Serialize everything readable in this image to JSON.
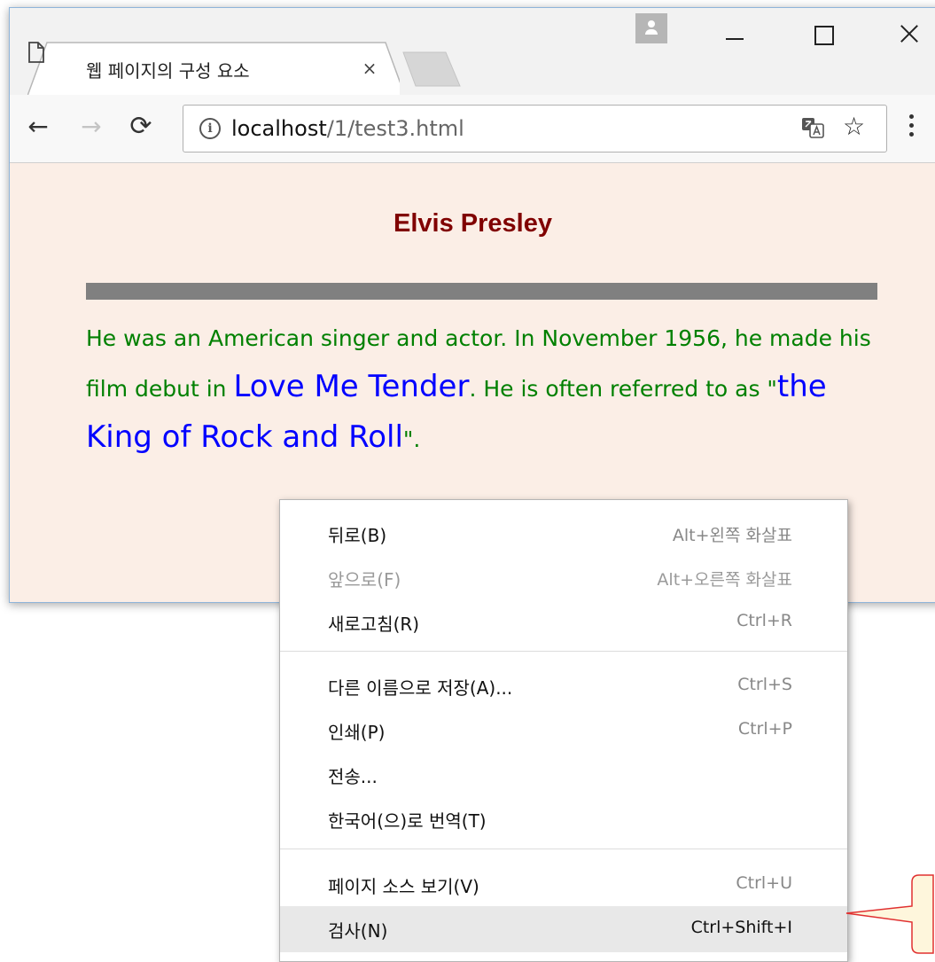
{
  "browser": {
    "tab_title": "웹 페이지의 구성 요소",
    "tab_close": "×",
    "url_host": "localhost",
    "url_path": "/1/test3.html",
    "star": "☆"
  },
  "page": {
    "heading": "Elvis Presley",
    "para_1": "He was an American singer and actor. In November 1956, he made his film debut in ",
    "film": "Love Me Tender",
    "para_2": ". He is often referred to as \"",
    "nickname": "the King of Rock and Roll",
    "para_3": "\"."
  },
  "context_menu": {
    "items": [
      {
        "label": "뒤로(B)",
        "shortcut": "Alt+왼쪽 화살표"
      },
      {
        "label": "앞으로(F)",
        "shortcut": "Alt+오른쪽 화살표"
      },
      {
        "label": "새로고침(R)",
        "shortcut": "Ctrl+R"
      },
      {
        "label": "다른 이름으로 저장(A)...",
        "shortcut": "Ctrl+S"
      },
      {
        "label": "인쇄(P)",
        "shortcut": "Ctrl+P"
      },
      {
        "label": "전송...",
        "shortcut": ""
      },
      {
        "label": "한국어(으)로 번역(T)",
        "shortcut": ""
      },
      {
        "label": "페이지 소스 보기(V)",
        "shortcut": "Ctrl+U"
      },
      {
        "label": "검사(N)",
        "shortcut": "Ctrl+Shift+I"
      }
    ]
  }
}
